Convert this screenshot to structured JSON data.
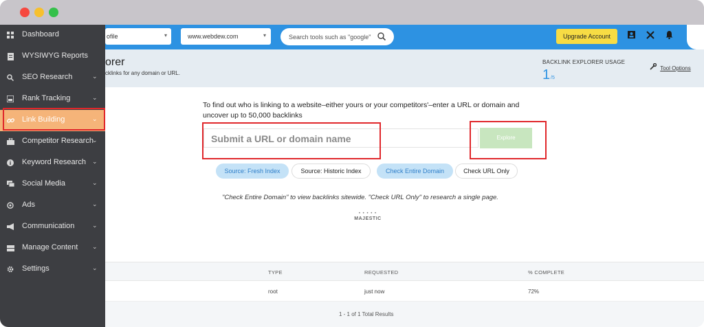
{
  "window": {
    "controls": [
      "close",
      "minimize",
      "maximize"
    ]
  },
  "sidebar": {
    "items": [
      {
        "label": "Dashboard",
        "icon": "dashboard-icon",
        "chevron": false
      },
      {
        "label": "WYSIWYG Reports",
        "icon": "reports-icon",
        "chevron": false
      },
      {
        "label": "SEO Research",
        "icon": "search-icon",
        "chevron": true
      },
      {
        "label": "Rank Tracking",
        "icon": "rank-tracking-icon",
        "chevron": true
      },
      {
        "label": "Link Building",
        "icon": "link-icon",
        "chevron": true,
        "active": true
      },
      {
        "label": "Competitor Research",
        "icon": "competitor-icon",
        "chevron": true
      },
      {
        "label": "Keyword Research",
        "icon": "info-icon",
        "chevron": true
      },
      {
        "label": "Social Media",
        "icon": "social-icon",
        "chevron": true
      },
      {
        "label": "Ads",
        "icon": "ads-icon",
        "chevron": true
      },
      {
        "label": "Communication",
        "icon": "megaphone-icon",
        "chevron": true
      },
      {
        "label": "Manage Content",
        "icon": "content-icon",
        "chevron": true
      },
      {
        "label": "Settings",
        "icon": "gear-icon",
        "chevron": true
      }
    ]
  },
  "topbar": {
    "profile_select": "ofile",
    "domain_select": "www.webdew.com",
    "search_placeholder": "Search tools such as \"google\"",
    "upgrade_label": "Upgrade Account",
    "icons": [
      "contact-icon",
      "tools-icon",
      "bell-icon"
    ]
  },
  "header": {
    "title": "orer",
    "subtitle": "cklinks for any domain or URL.",
    "usage_label": "BACKLINK EXPLORER USAGE",
    "usage_used": "1",
    "usage_total": "/5",
    "tool_options": "Tool Options"
  },
  "main": {
    "intro": "To find out who is linking to a website–either yours or your competitors'–enter a URL or domain and uncover up to 50,000 backlinks",
    "url_placeholder": "Submit a URL or domain name",
    "explore_label": "Explore",
    "pills": {
      "fresh": "Source: Fresh Index",
      "historic": "Source: Historic Index",
      "entire": "Check Entire Domain",
      "url_only": "Check URL Only"
    },
    "help": "\"Check Entire Domain\" to view backlinks sitewide. \"Check URL Only\" to research a single page.",
    "majestic_logo": "MAJESTIC"
  },
  "table": {
    "headers": [
      "TYPE",
      "REQUESTED",
      "% COMPLETE"
    ],
    "rows": [
      {
        "type": "root",
        "requested": "just now",
        "complete": "72%"
      }
    ],
    "results": "1 - 1 of 1 Total Results"
  },
  "colors": {
    "topbar": "#2d92e2",
    "sidebar": "#3d3e42",
    "active_nav": "#f5b479",
    "highlight": "#e0262a",
    "upgrade": "#f7dc44",
    "explore": "#c8e6bf"
  }
}
